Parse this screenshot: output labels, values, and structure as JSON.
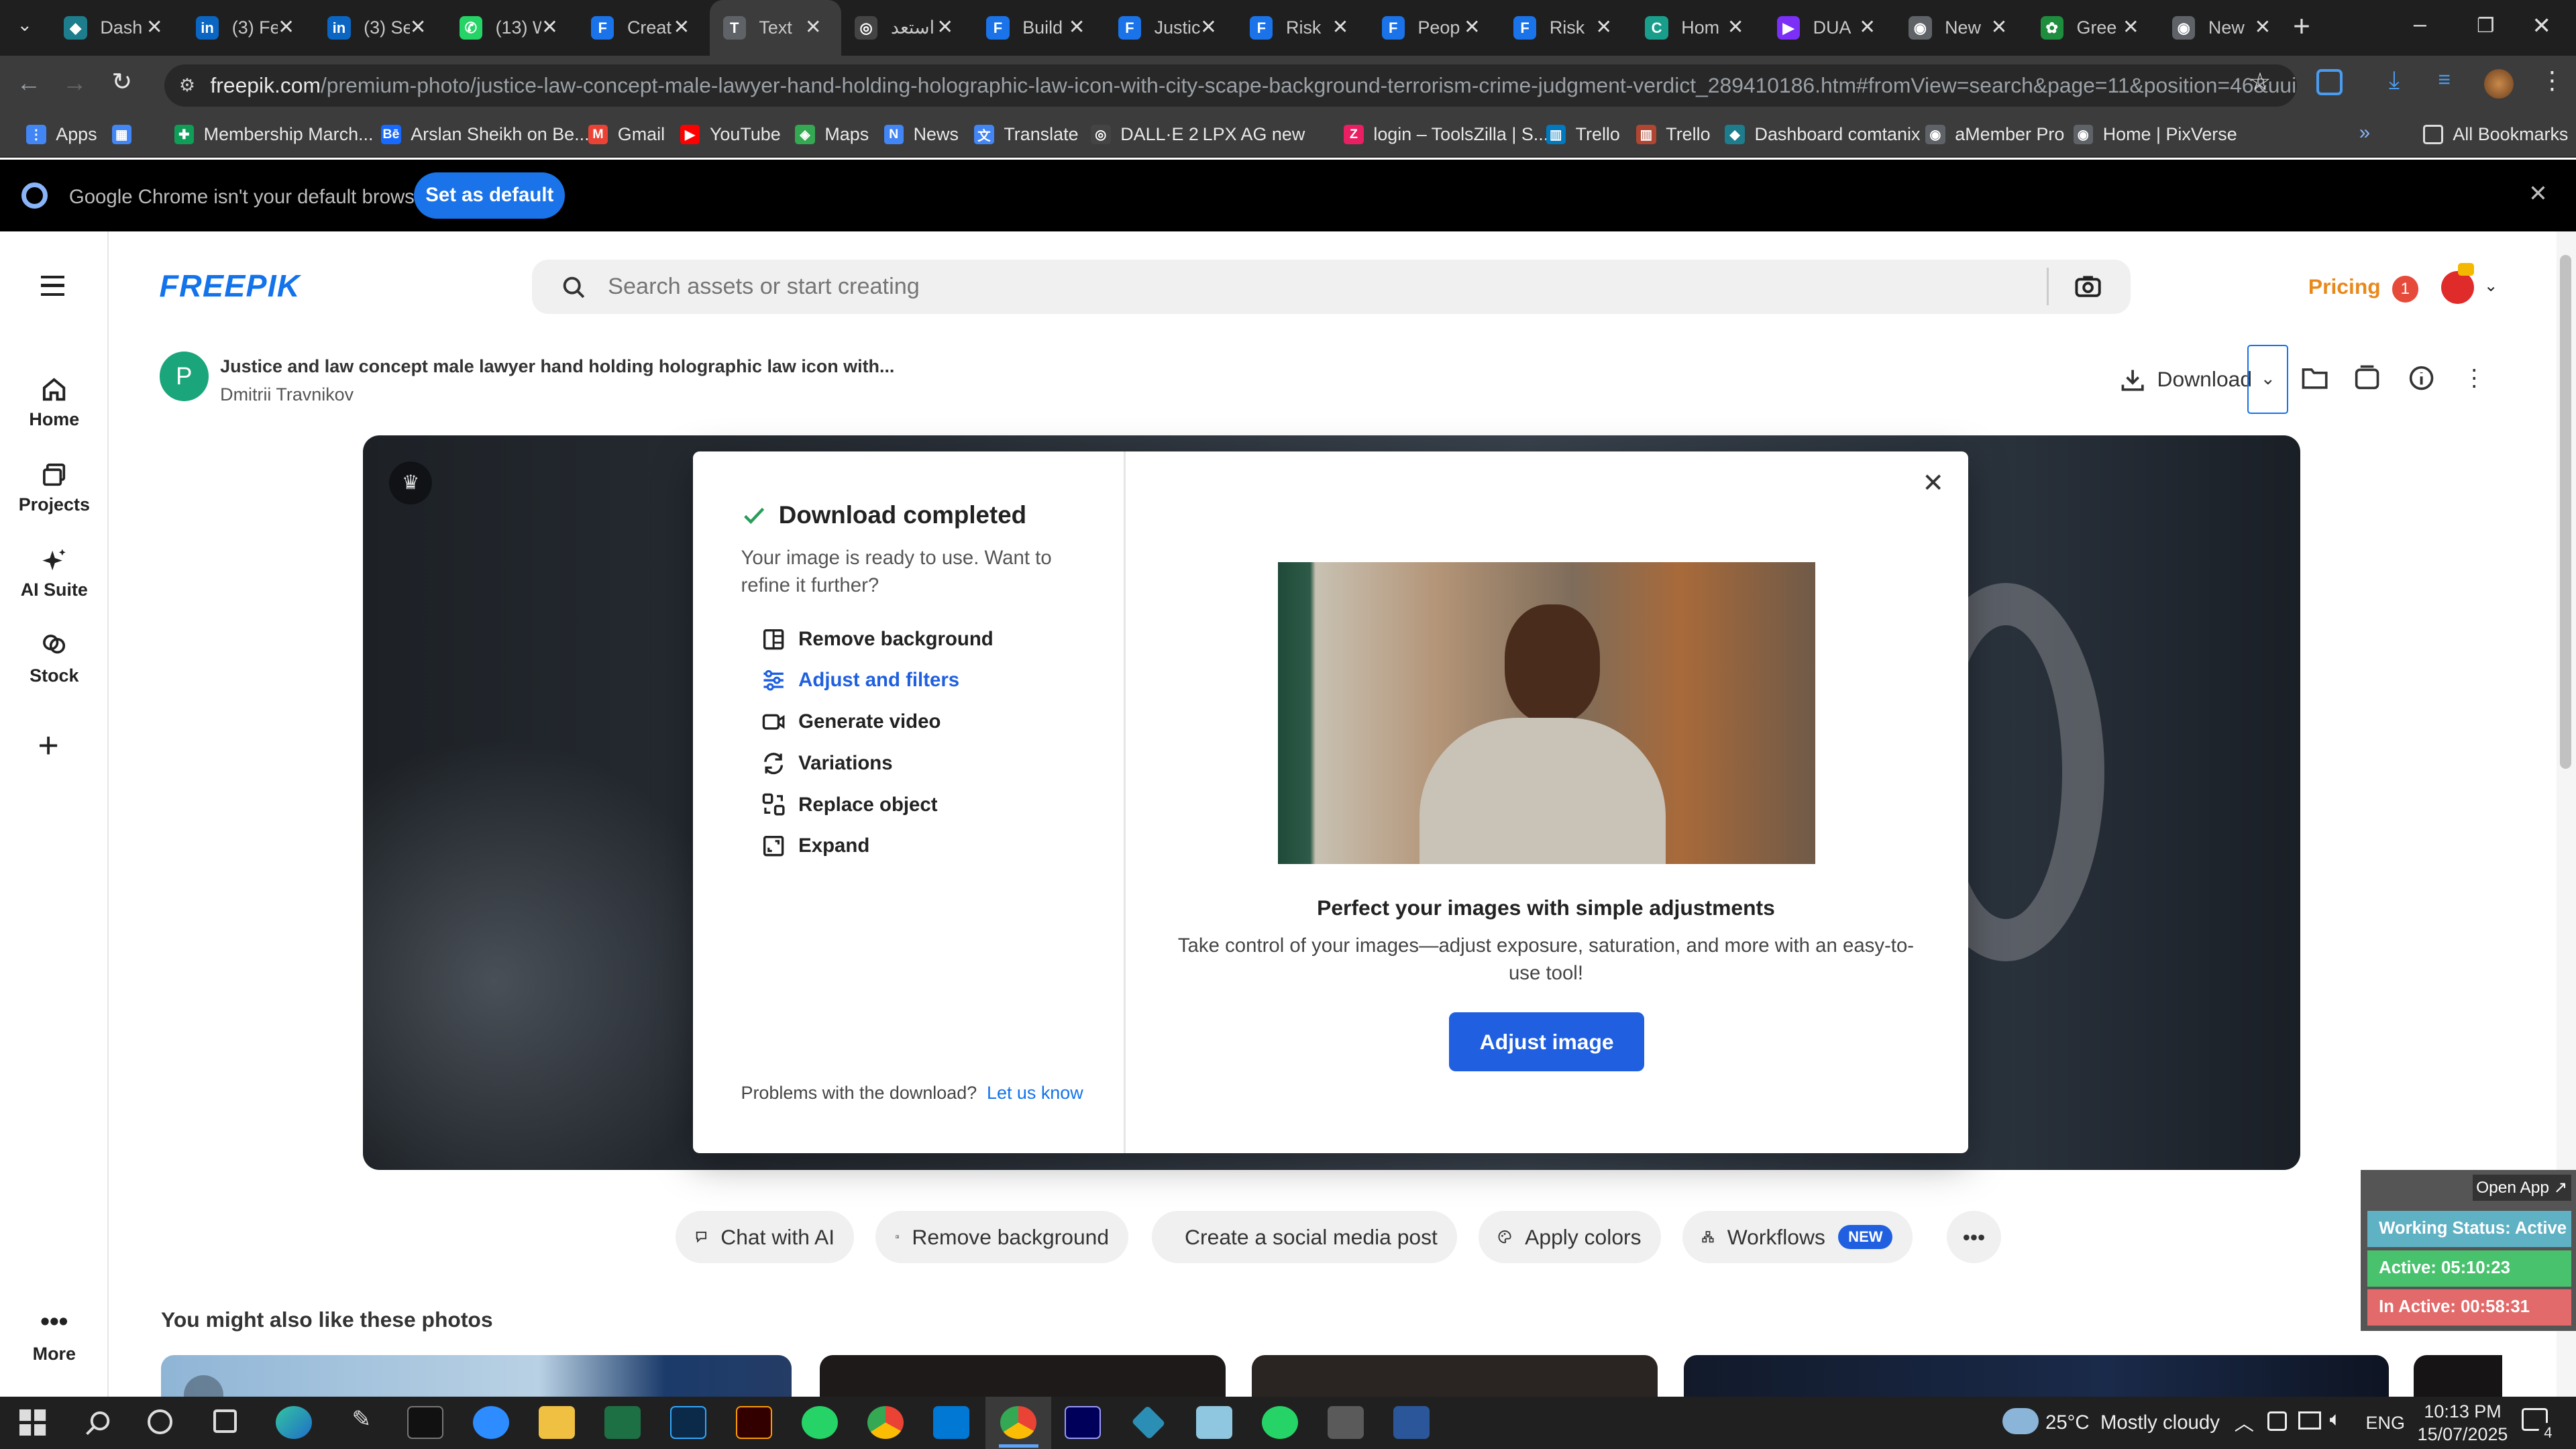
{
  "browser": {
    "tabs": [
      {
        "title": "Dash",
        "color": "#1e7d8c",
        "glyph": "◆"
      },
      {
        "title": "(3) Fe",
        "color": "#0a66c2",
        "glyph": "in"
      },
      {
        "title": "(3) Se",
        "color": "#0a66c2",
        "glyph": "in"
      },
      {
        "title": "(13) W",
        "color": "#25d366",
        "glyph": "✆"
      },
      {
        "title": "Creat",
        "color": "#1a73e8",
        "glyph": "F"
      },
      {
        "title": "Text",
        "color": "#5f6368",
        "glyph": "T"
      },
      {
        "title": "استعد",
        "color": "#444444",
        "glyph": "◎"
      },
      {
        "title": "Build",
        "color": "#1a73e8",
        "glyph": "F"
      },
      {
        "title": "Justic",
        "color": "#1a73e8",
        "glyph": "F"
      },
      {
        "title": "Risk",
        "color": "#1a73e8",
        "glyph": "F"
      },
      {
        "title": "Peop",
        "color": "#1a73e8",
        "glyph": "F"
      },
      {
        "title": "Risk",
        "color": "#1a73e8",
        "glyph": "F"
      },
      {
        "title": "Hom",
        "color": "#1a9e8c",
        "glyph": "C"
      },
      {
        "title": "DUA",
        "color": "#7b2ff7",
        "glyph": "▶"
      },
      {
        "title": "New",
        "color": "#5f6368",
        "glyph": "◉"
      },
      {
        "title": "Gree",
        "color": "#1e8e3e",
        "glyph": "✿"
      },
      {
        "title": "New",
        "color": "#5f6368",
        "glyph": "◉"
      }
    ],
    "url_host": "freepik.com",
    "url_path": "/premium-photo/justice-law-concept-male-lawyer-hand-holding-holographic-law-icon-with-city-scape-background-terrorism-crime-judgment-verdict_289410186.htm#fromView=search&page=11&position=46&uuid=ca2fac46-37...",
    "bookmarks": [
      {
        "label": "Apps",
        "color": "#4285f4",
        "glyph": "⋮"
      },
      {
        "label": "",
        "color": "#4285f4",
        "glyph": "▦"
      },
      {
        "label": "Membership March...",
        "color": "#0f9d58",
        "glyph": "✚"
      },
      {
        "label": "Arslan Sheikh on Be...",
        "color": "#1769ff",
        "glyph": "Bē"
      },
      {
        "label": "Gmail",
        "color": "#ea4335",
        "glyph": "M"
      },
      {
        "label": "YouTube",
        "color": "#ff0000",
        "glyph": "▶"
      },
      {
        "label": "Maps",
        "color": "#34a853",
        "glyph": "◈"
      },
      {
        "label": "News",
        "color": "#4285f4",
        "glyph": "N"
      },
      {
        "label": "Translate",
        "color": "#4285f4",
        "glyph": "文"
      },
      {
        "label": "DALL·E 2",
        "color": "#444444",
        "glyph": "◎"
      },
      {
        "label": "LPX AG new",
        "color": "#3c3c3c",
        "glyph": ""
      },
      {
        "label": "login – ToolsZilla | S...",
        "color": "#e91e63",
        "glyph": "Z"
      },
      {
        "label": "Trello",
        "color": "#0079bf",
        "glyph": "▥"
      },
      {
        "label": "Trello",
        "color": "#b04632",
        "glyph": "▥"
      },
      {
        "label": "Dashboard comtanix",
        "color": "#1e7d8c",
        "glyph": "◆"
      },
      {
        "label": "aMember Pro",
        "color": "#5f6368",
        "glyph": "◉"
      },
      {
        "label": "Home | PixVerse",
        "color": "#5f6368",
        "glyph": "◉"
      }
    ],
    "all_bookmarks_label": "All Bookmarks",
    "infobar_text": "Google Chrome isn't your default browser",
    "infobar_button": "Set as default"
  },
  "header": {
    "logo": "FREEPIK",
    "search_placeholder": "Search assets or start creating",
    "pricing_label": "Pricing",
    "notification_count": "1"
  },
  "leftnav": {
    "items": [
      {
        "label": "Home"
      },
      {
        "label": "Projects"
      },
      {
        "label": "AI Suite"
      },
      {
        "label": "Stock"
      }
    ],
    "more_label": "More"
  },
  "asset": {
    "avatar_letter": "P",
    "title": "Justice and law concept male lawyer hand holding holographic law icon with...",
    "author": "Dmitrii Travnikov",
    "download_label": "Download"
  },
  "modal": {
    "title": "Download completed",
    "subtitle": "Your image is ready to use. Want to refine it further?",
    "actions": [
      {
        "label": "Remove background",
        "icon": "remove-background-icon",
        "active": false
      },
      {
        "label": "Adjust and filters",
        "icon": "sliders-icon",
        "active": true
      },
      {
        "label": "Generate video",
        "icon": "video-icon",
        "active": false
      },
      {
        "label": "Variations",
        "icon": "refresh-icon",
        "active": false
      },
      {
        "label": "Replace object",
        "icon": "replace-object-icon",
        "active": false
      },
      {
        "label": "Expand",
        "icon": "expand-icon",
        "active": false
      }
    ],
    "problem_text": "Problems with the download?",
    "problem_link": "Let us know",
    "promo_title": "Perfect your images with simple adjustments",
    "promo_text": "Take control of your images—adjust exposure, saturation, and more with an easy-to-use tool!",
    "promo_button": "Adjust image"
  },
  "tools": [
    {
      "label": "Chat with AI",
      "icon": "chat-icon"
    },
    {
      "label": "Remove background",
      "icon": "remove-background-icon"
    },
    {
      "label": "Create a social media post",
      "icon": "phone-icon"
    },
    {
      "label": "Apply colors",
      "icon": "palette-icon"
    },
    {
      "label": "Workflows",
      "icon": "workflow-icon",
      "badge": "NEW"
    }
  ],
  "related_title": "You might also like these photos",
  "tracker": {
    "open_app": "Open App ↗",
    "status": "Working Status: Active",
    "active": "Active: 05:10:23",
    "inactive": "In Active: 00:58:31"
  },
  "taskbar": {
    "weather": "25°C  Mostly cloudy",
    "lang": "ENG",
    "time": "10:13 PM",
    "date": "15/07/2025",
    "notif_count": "4"
  }
}
